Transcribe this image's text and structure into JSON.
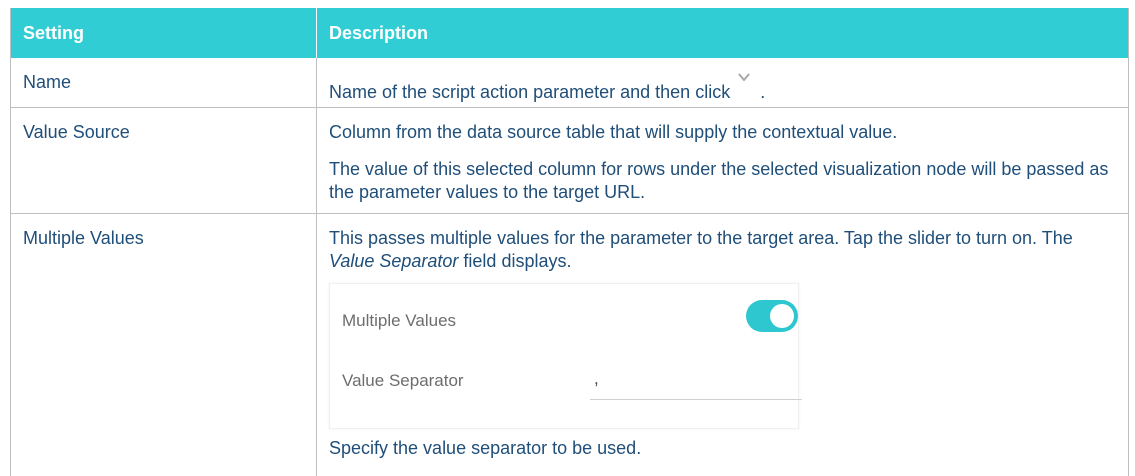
{
  "header": {
    "col1": "Setting",
    "col2": "Description"
  },
  "rows": {
    "name": {
      "setting": "Name",
      "desc": "Name of the script action parameter and then click",
      "desc_end": ".",
      "icon": "chevron-down-icon"
    },
    "value_source": {
      "setting": "Value Source",
      "desc1": "Column from the data source table that will supply the contextual value.",
      "desc2": "The value of this selected column for rows under the selected visualization node will be passed as the parameter values to the target URL."
    },
    "multiple_values": {
      "setting": "Multiple Values",
      "desc_a": "This passes multiple values for the parameter to the target area. Tap the slider to turn on. The ",
      "desc_em": "Value Separator",
      "desc_b": " field displays.",
      "panel": {
        "toggle_label": "Multiple Values",
        "toggle_on": true,
        "separator_label": "Value Separator",
        "separator_value": ","
      },
      "desc_after": "Specify the value separator to be used."
    }
  },
  "colors": {
    "header_bg": "#31cdd4",
    "text": "#1f4e79",
    "toggle": "#2fc7cf"
  }
}
